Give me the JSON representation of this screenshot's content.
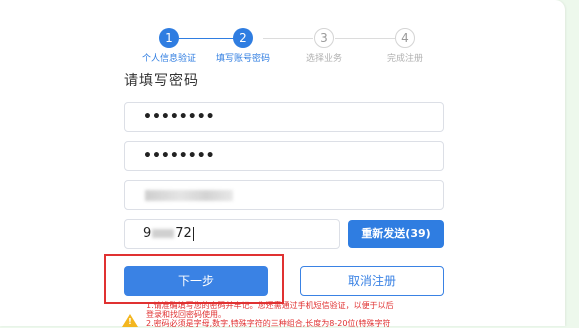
{
  "stepper": {
    "steps": [
      {
        "number": "1",
        "label": "个人信息验证",
        "state": "active"
      },
      {
        "number": "2",
        "label": "填写账号密码",
        "state": "active"
      },
      {
        "number": "3",
        "label": "选择业务",
        "state": "inactive"
      },
      {
        "number": "4",
        "label": "完成注册",
        "state": "inactive"
      }
    ]
  },
  "form": {
    "heading": "请填写密码",
    "password": "••••••••",
    "confirm_password": "••••••••",
    "code_prefix": "9",
    "code_suffix": "72",
    "resend_label": "重新发送(39)"
  },
  "actions": {
    "next_label": "下一步",
    "cancel_label": "取消注册"
  },
  "notes": {
    "line1": "1.请准确填写您的密码并牢记。您还需通过手机短信验证，以便于以后",
    "line2": "登录和找回密码使用。",
    "line3": "2.密码必须是字母,数字,特殊字符的三种组合,长度为8-20位(特殊字符"
  },
  "colors": {
    "accent": "#2f7de1",
    "highlight": "#e03131",
    "warning": "#f3b61f"
  }
}
